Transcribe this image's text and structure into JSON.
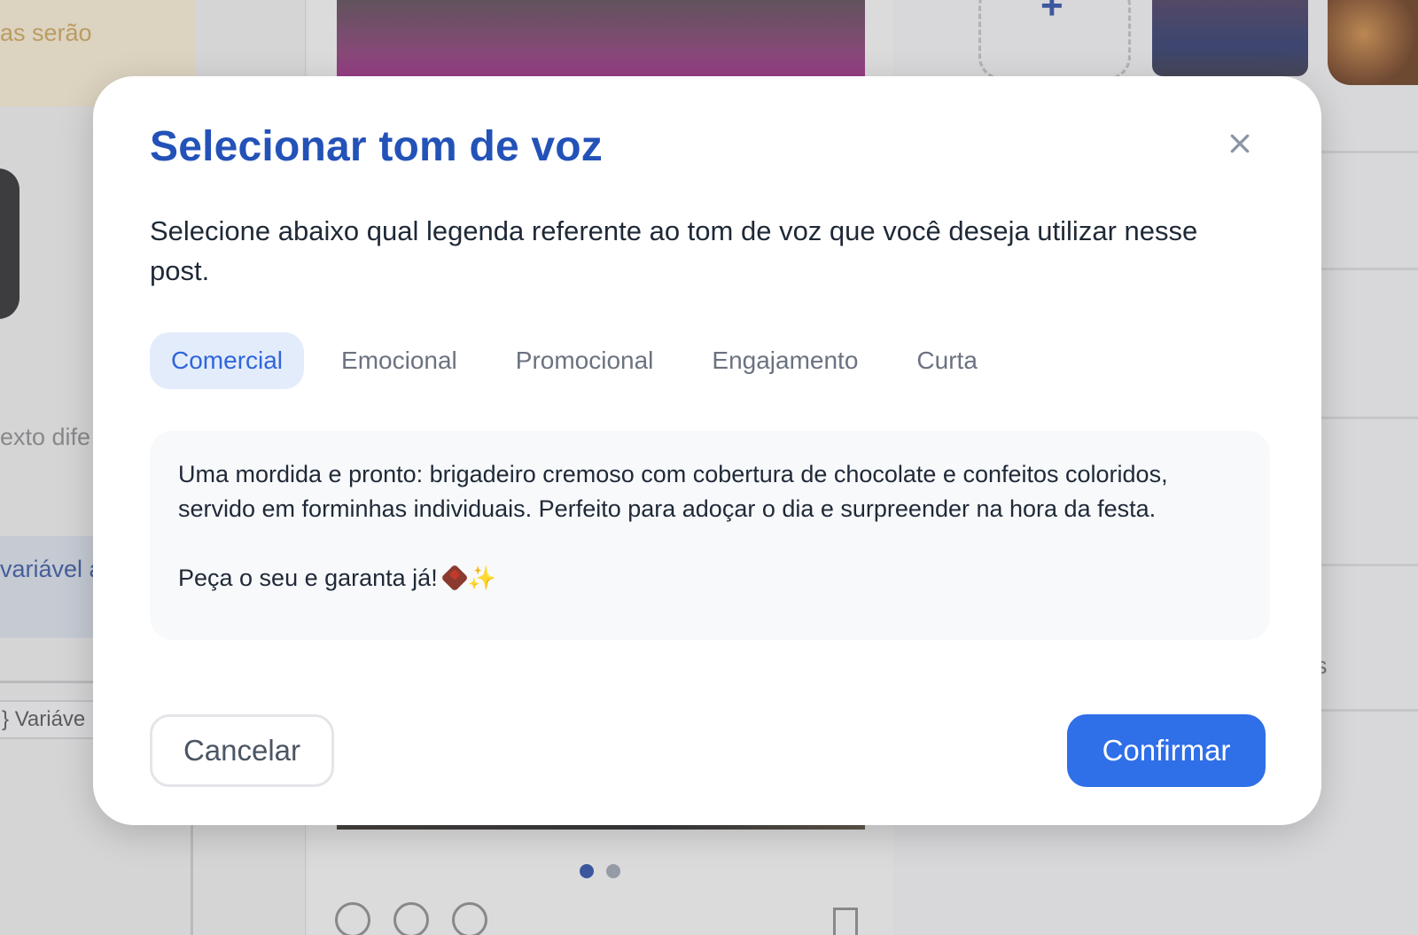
{
  "background": {
    "warning_text": "as serão",
    "text_cut": "exto dife",
    "variable_text": "variável a",
    "chip_label": "Variáve",
    "right_letter": "s",
    "add_label": "+"
  },
  "modal": {
    "title": "Selecionar tom de voz",
    "description": "Selecione abaixo qual legenda referente ao tom de voz que você deseja utilizar nesse post.",
    "tabs": [
      {
        "label": "Comercial",
        "active": true
      },
      {
        "label": "Emocional",
        "active": false
      },
      {
        "label": "Promocional",
        "active": false
      },
      {
        "label": "Engajamento",
        "active": false
      },
      {
        "label": "Curta",
        "active": false
      }
    ],
    "caption": {
      "paragraph1": "Uma mordida e pronto: brigadeiro cremoso com cobertura de chocolate e confeitos coloridos, servido em forminhas individuais. Perfeito para adoçar o dia e surpreender na hora da festa.",
      "paragraph2": "Peça o seu e garanta já!",
      "emojis": [
        "chocolate-bar-emoji",
        "sparkles-emoji"
      ]
    },
    "cancel_label": "Cancelar",
    "confirm_label": "Confirmar"
  },
  "carousel": {
    "total": 2,
    "active_index": 0
  },
  "colors": {
    "title": "#2352b8",
    "primary": "#2f6fe8",
    "active_tab_bg": "#e3ecfb",
    "active_tab_text": "#2f66d8"
  }
}
